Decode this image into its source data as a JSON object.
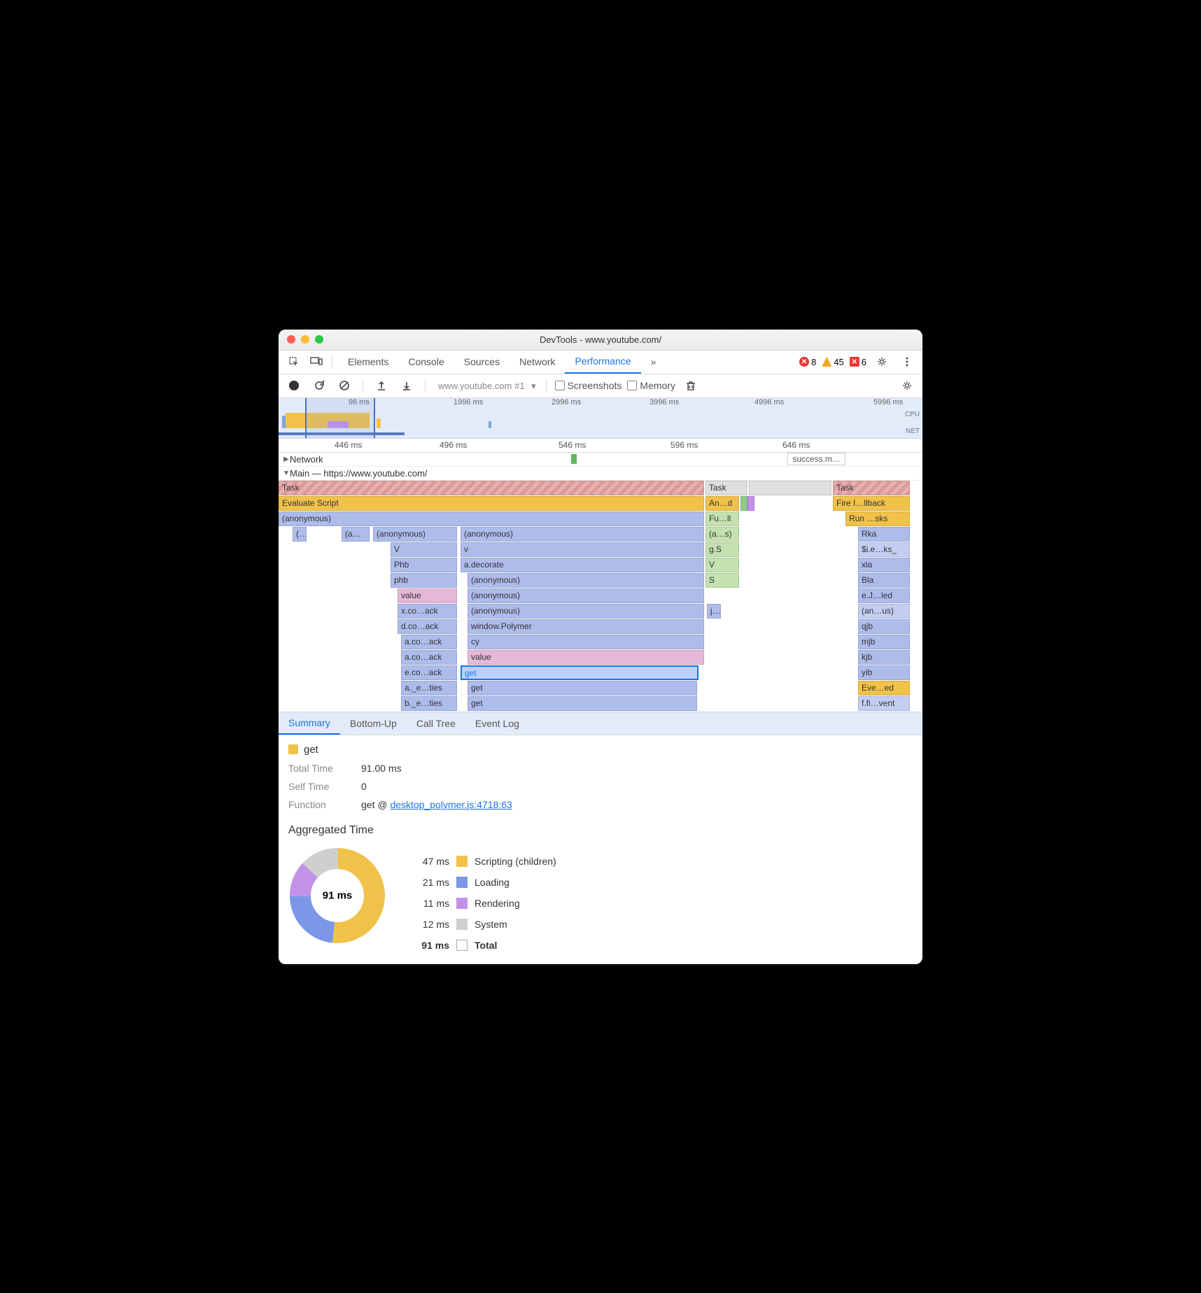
{
  "window_title": "DevTools - www.youtube.com/",
  "main_tabs": [
    "Elements",
    "Console",
    "Sources",
    "Network",
    "Performance"
  ],
  "main_tab_active": 4,
  "badges": {
    "error": 8,
    "warn": 45,
    "red2": 6
  },
  "record_dropdown": "www.youtube.com #1",
  "checkboxes": [
    "Screenshots",
    "Memory"
  ],
  "overview_ticks": [
    "96 ms",
    "1996 ms",
    "2996 ms",
    "3996 ms",
    "4996 ms",
    "5996 ms"
  ],
  "overview_side": [
    "CPU",
    "NET"
  ],
  "ruler_ticks": [
    "446 ms",
    "496 ms",
    "546 ms",
    "596 ms",
    "646 ms"
  ],
  "tree": {
    "network_label": "Network",
    "success_label": "success.m…",
    "main_label": "Main — https://www.youtube.com/"
  },
  "flame": {
    "col1": {
      "task": "Task",
      "eval": "Evaluate Script",
      "anon": "(anonymous)",
      "t1": "(…",
      "t2": "(a…s)"
    },
    "col2": [
      "(anonymous)",
      "V",
      "Phb",
      "phb",
      "value",
      "x.co…ack",
      "d.co…ack",
      "a.co…ack",
      "a.co…ack",
      "e.co…ack",
      "a._e…ties",
      "b._e…ties"
    ],
    "col3": [
      "(anonymous)",
      "v",
      "a.decorate",
      "(anonymous)",
      "(anonymous)",
      "(anonymous)",
      "window.Polymer",
      "cy",
      "value",
      "get",
      "get",
      "get"
    ],
    "col4": {
      "task": "Task",
      "and": "An…d",
      "full": "Fu…ll",
      "as": "(a…s)",
      "gs": "g.S",
      "v": "V",
      "s": "S",
      "j": "j…"
    },
    "col5": {
      "task": "Task",
      "fire": "Fire I…llback",
      "run": "Run …sks",
      "items": [
        "Rka",
        "$i.e…ks_",
        "xla",
        "Bla",
        "e.J…led",
        "(an…us)",
        "qjb",
        "mjb",
        "kjb",
        "yib",
        "Eve…ed",
        "f.fi…vent"
      ]
    }
  },
  "detail_tabs": [
    "Summary",
    "Bottom-Up",
    "Call Tree",
    "Event Log"
  ],
  "detail_tab_active": 0,
  "summary": {
    "fn_name": "get",
    "total_label": "Total Time",
    "total_val": "91.00 ms",
    "self_label": "Self Time",
    "self_val": "0",
    "func_label": "Function",
    "func_prefix": "get @ ",
    "func_link": "desktop_polymer.js:4718:63"
  },
  "agg": {
    "title": "Aggregated Time",
    "center": "91 ms",
    "rows": [
      {
        "t": "47 ms",
        "sw": "sw-script",
        "n": "Scripting (children)"
      },
      {
        "t": "21 ms",
        "sw": "sw-load",
        "n": "Loading"
      },
      {
        "t": "11 ms",
        "sw": "sw-render",
        "n": "Rendering"
      },
      {
        "t": "12 ms",
        "sw": "sw-system",
        "n": "System"
      },
      {
        "t": "91 ms",
        "sw": "sw-total",
        "n": "Total"
      }
    ]
  },
  "chart_data": {
    "type": "pie",
    "title": "Aggregated Time",
    "categories": [
      "Scripting (children)",
      "Loading",
      "Rendering",
      "System"
    ],
    "values": [
      47,
      21,
      11,
      12
    ],
    "total": 91,
    "unit": "ms"
  }
}
